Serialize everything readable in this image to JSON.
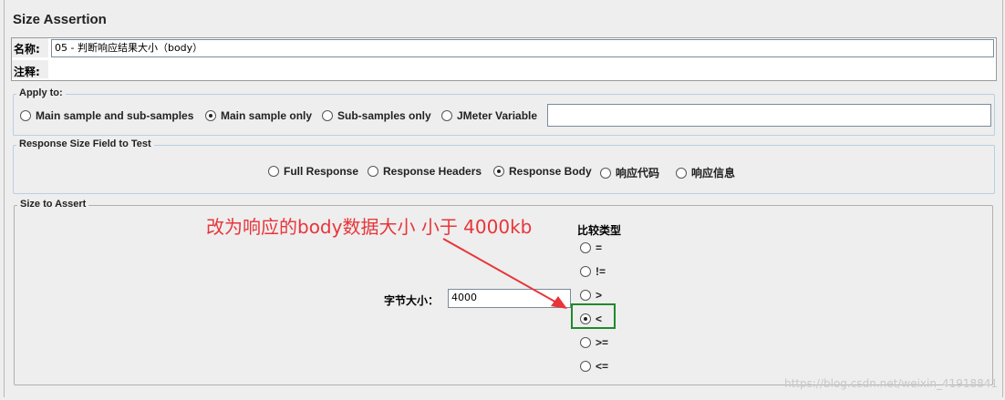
{
  "panel": {
    "title": "Size Assertion"
  },
  "name_field": {
    "label": "名称:",
    "value": "05 - 判断响应结果大小（body）"
  },
  "comment_field": {
    "label": "注释:",
    "value": ""
  },
  "apply_to": {
    "legend": "Apply to:",
    "options": [
      {
        "label": "Main sample and sub-samples",
        "selected": false
      },
      {
        "label": "Main sample only",
        "selected": true
      },
      {
        "label": "Sub-samples only",
        "selected": false
      },
      {
        "label": "JMeter Variable",
        "selected": false
      }
    ],
    "variable_value": ""
  },
  "response_field": {
    "legend": "Response Size Field to Test",
    "options": [
      {
        "label": "Full Response",
        "selected": false
      },
      {
        "label": "Response Headers",
        "selected": false
      },
      {
        "label": "Response Body",
        "selected": true
      },
      {
        "label": "响应代码",
        "selected": false
      },
      {
        "label": "响应信息",
        "selected": false
      }
    ]
  },
  "size_to_assert": {
    "legend": "Size to Assert",
    "size_label": "字节大小：",
    "size_value": "4000",
    "comparison_label": "比较类型",
    "comparison_options": [
      {
        "label": "=",
        "selected": false
      },
      {
        "label": "!=",
        "selected": false
      },
      {
        "label": ">",
        "selected": false
      },
      {
        "label": "<",
        "selected": true
      },
      {
        "label": ">=",
        "selected": false
      },
      {
        "label": "<=",
        "selected": false
      }
    ]
  },
  "annotation": {
    "text": "改为响应的body数据大小 小于 4000kb",
    "color": "#e8353a",
    "highlight_color": "#1f8a2a"
  },
  "watermark": "https://blog.csdn.net/weixin_41918841"
}
